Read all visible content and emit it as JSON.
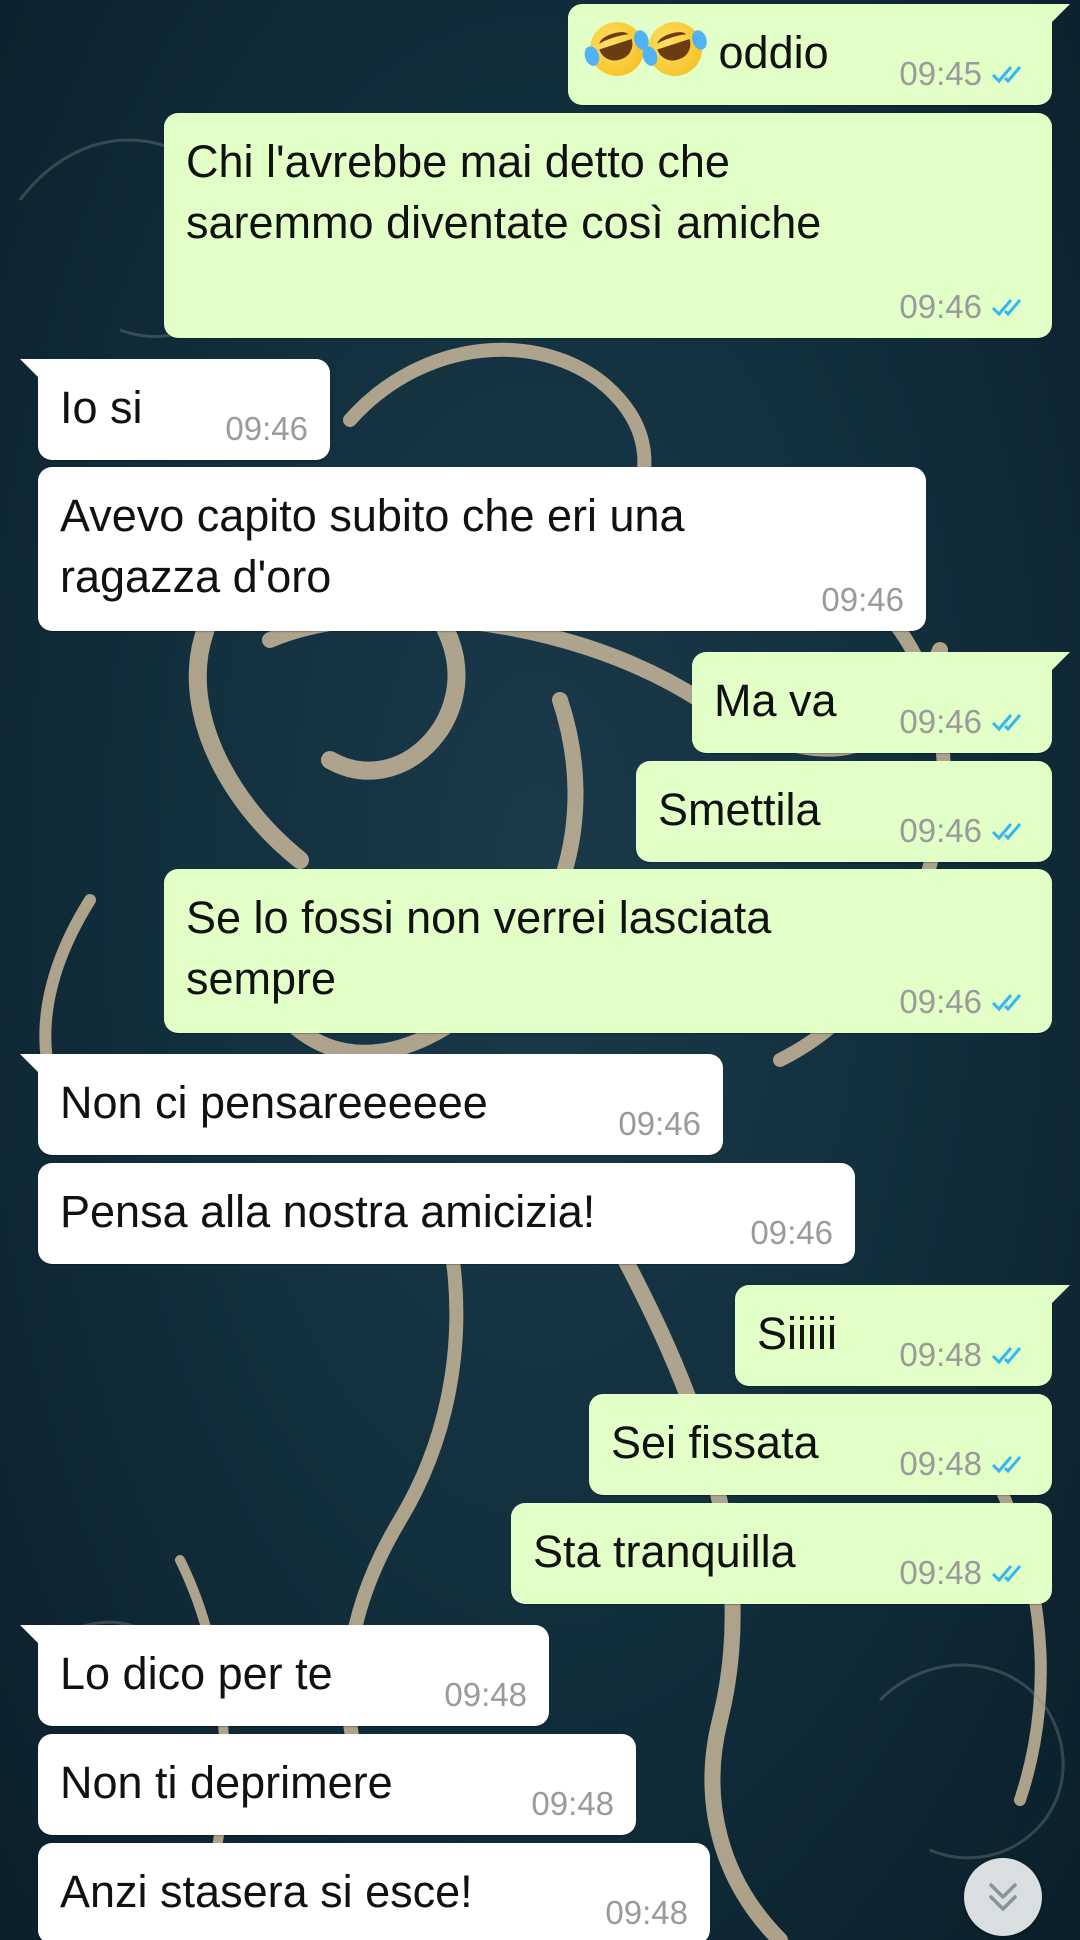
{
  "messages": [
    {
      "dir": "out",
      "text": "oddio",
      "time": "09:45",
      "emoji": "rolling-on-floor-laughing",
      "emoji_count": 2
    },
    {
      "dir": "out",
      "text": "Chi l'avrebbe mai detto che\nsaremmo diventate così amiche",
      "time": "09:46"
    },
    {
      "dir": "in",
      "text": "Io si",
      "time": "09:46"
    },
    {
      "dir": "in",
      "text": "Avevo capito subito che eri una\nragazza d'oro",
      "time": "09:46"
    },
    {
      "dir": "out",
      "text": "Ma va",
      "time": "09:46"
    },
    {
      "dir": "out",
      "text": "Smettila",
      "time": "09:46"
    },
    {
      "dir": "out",
      "text": "Se lo fossi non verrei lasciata\nsempre",
      "time": "09:46"
    },
    {
      "dir": "in",
      "text": "Non ci pensareeeeee",
      "time": "09:46"
    },
    {
      "dir": "in",
      "text": "Pensa alla nostra amicizia!",
      "time": "09:46"
    },
    {
      "dir": "out",
      "text": "Siiiii",
      "time": "09:48"
    },
    {
      "dir": "out",
      "text": "Sei fissata",
      "time": "09:48"
    },
    {
      "dir": "out",
      "text": "Sta tranquilla",
      "time": "09:48"
    },
    {
      "dir": "in",
      "text": "Lo dico per te",
      "time": "09:48"
    },
    {
      "dir": "in",
      "text": "Non ti deprimere",
      "time": "09:48"
    },
    {
      "dir": "in",
      "text": "Anzi stasera si esce!",
      "time": "09:48"
    }
  ],
  "icons": {
    "read_receipt": "double-check-icon",
    "scroll_down": "double-chevron-down-icon"
  },
  "colors": {
    "outgoing_bubble": "#e1ffc7",
    "incoming_bubble": "#ffffff",
    "timestamp": "#9a9a9a",
    "read_tick": "#34b7f1",
    "wallpaper": "#12303e",
    "ornament": "#c9b79a"
  }
}
